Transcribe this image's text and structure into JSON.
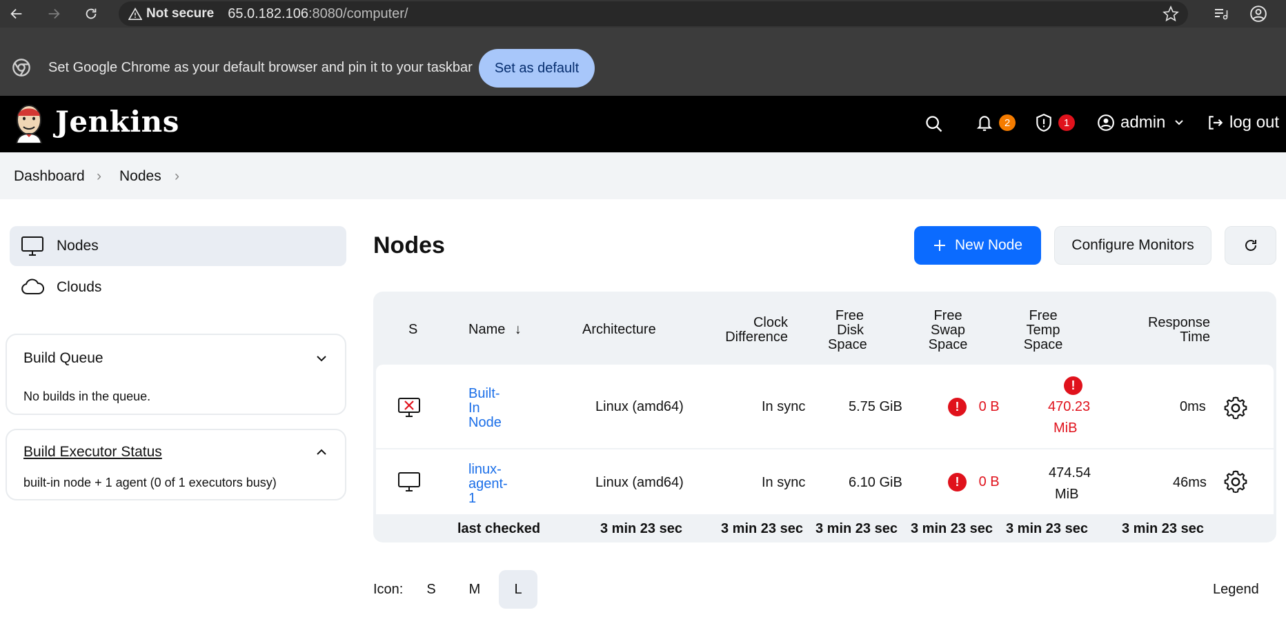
{
  "browser": {
    "not_secure_label": "Not secure",
    "url_host": "65.0.182.106",
    "url_rest": ":8080/computer/"
  },
  "infobar": {
    "message": "Set Google Chrome as your default browser and pin it to your taskbar",
    "button_label": "Set as default"
  },
  "header": {
    "brand": "Jenkins",
    "notifications_count": "2",
    "security_count": "1",
    "user": "admin",
    "logout_label": "log out",
    "colors": {
      "notification_badge": "#f57c00",
      "security_badge": "#e0121c"
    }
  },
  "breadcrumb": {
    "items": [
      "Dashboard",
      "Nodes"
    ]
  },
  "sidebar": {
    "items": [
      {
        "label": "Nodes",
        "icon": "computer-icon",
        "active": true
      },
      {
        "label": "Clouds",
        "icon": "cloud-icon",
        "active": false
      }
    ],
    "build_queue": {
      "title": "Build Queue",
      "text": "No builds in the queue."
    },
    "executor_status": {
      "title": "Build Executor Status",
      "text": "built-in node + 1 agent (0 of 1 executors busy)"
    }
  },
  "main": {
    "title": "Nodes",
    "new_node_label": "New Node",
    "configure_monitors_label": "Configure Monitors"
  },
  "table": {
    "headers": {
      "s": "S",
      "name": "Name",
      "sort_arrow": "↓",
      "architecture": "Architecture",
      "clock_1": "Clock",
      "clock_2": "Difference",
      "disk_1": "Free",
      "disk_2": "Disk",
      "disk_3": "Space",
      "swap_1": "Free",
      "swap_2": "Swap",
      "swap_3": "Space",
      "temp_1": "Free",
      "temp_2": "Temp",
      "temp_3": "Space",
      "resp_1": "Response",
      "resp_2": "Time"
    },
    "rows": [
      {
        "name_lines": [
          "Built-",
          "In",
          "Node"
        ],
        "offline": true,
        "architecture": "Linux (amd64)",
        "clock": "In sync",
        "disk": "5.75 GiB",
        "swap": "0 B",
        "temp_1": "470.23",
        "temp_2": "MiB",
        "response": "0ms"
      },
      {
        "name_lines": [
          "linux-",
          "agent-",
          "1"
        ],
        "offline": false,
        "architecture": "Linux (amd64)",
        "clock": "In sync",
        "disk": "6.10 GiB",
        "swap": "0 B",
        "temp_1": "474.54",
        "temp_2": "MiB",
        "response": "46ms"
      }
    ],
    "last_checked_label": "last checked",
    "last_checked": {
      "architecture": "3 min 23 sec",
      "clock": "3 min 23 sec",
      "disk": "3 min 23 sec",
      "swap": "3 min 23 sec",
      "temp": "3 min 23 sec",
      "response": "3 min 23 sec"
    }
  },
  "footer": {
    "icon_label": "Icon:",
    "sizes": [
      "S",
      "M",
      "L"
    ],
    "selected_size": "L",
    "legend_label": "Legend"
  }
}
